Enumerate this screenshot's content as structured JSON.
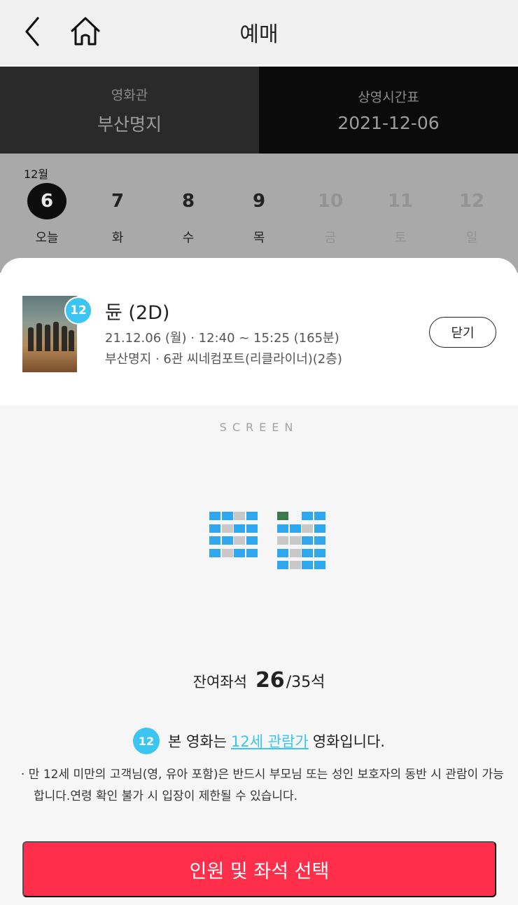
{
  "header": {
    "title": "예매",
    "back_icon": "chevron-left-icon",
    "home_icon": "home-icon"
  },
  "infobar": {
    "theater_label": "영화관",
    "theater_value": "부산명지",
    "schedule_label": "상영시간표",
    "schedule_value": "2021-12-06"
  },
  "calendar": {
    "month": "12월",
    "days": [
      {
        "num": "6",
        "name": "오늘"
      },
      {
        "num": "7",
        "name": "화"
      },
      {
        "num": "8",
        "name": "수"
      },
      {
        "num": "9",
        "name": "목"
      },
      {
        "num": "10",
        "name": "금"
      },
      {
        "num": "11",
        "name": "토"
      },
      {
        "num": "12",
        "name": "일"
      }
    ]
  },
  "movie": {
    "age": "12",
    "title": "듄 (2D)",
    "time": "21.12.06 (월) · 12:40 ~ 15:25 (165분)",
    "location": "부산명지 · 6관 씨네컴포트(리클라이너)(2층)",
    "close_label": "닫기"
  },
  "screen_label": "SCREEN",
  "remaining": {
    "label": "잔여좌석",
    "available": "26",
    "total": "/35석"
  },
  "rating_notice": {
    "badge": "12",
    "prefix": "본 영화는",
    "link": "12세 관람가",
    "suffix": "영화입니다."
  },
  "notice": "· 만 12세 미만의 고객님(영, 유아 포함)은 반드시 부모님 또는 성인 보호자의 동반 시 관람이 가능합니다.연령 확인 불가 시 입장이 제한될 수 있습니다.",
  "cta_label": "인원 및 좌석 선택",
  "colors": {
    "accent": "#ff2e4a",
    "badge": "#3cc5f0",
    "seat_available": "#2fa8f0",
    "seat_taken": "#c8c8c8",
    "seat_special": "#3c7a4e"
  },
  "seats": {
    "left_block": [
      [
        "a",
        "a",
        "t",
        "a"
      ],
      [
        "a",
        "t",
        "a",
        "a"
      ],
      [
        "a",
        "a",
        "t",
        "a"
      ],
      [
        "a",
        "t",
        "a",
        "a"
      ]
    ],
    "right_block": [
      [
        "s",
        null,
        "a",
        "a"
      ],
      [
        "a",
        "a",
        "t",
        "a"
      ],
      [
        "t",
        "t",
        "a",
        "a"
      ],
      [
        "a",
        "t",
        "a",
        "a"
      ],
      [
        "a",
        "t",
        "a",
        "a"
      ]
    ]
  }
}
